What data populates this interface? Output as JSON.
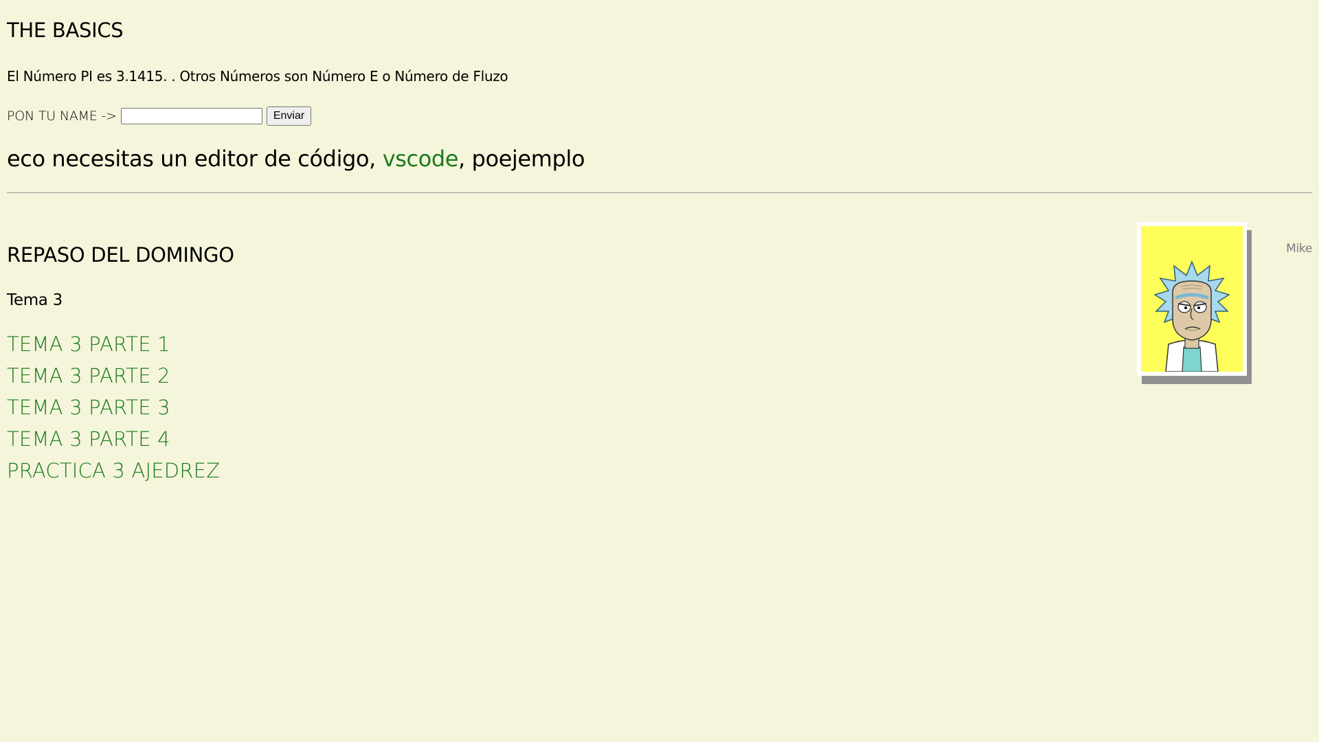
{
  "header": {
    "title": "THE BASICS"
  },
  "intro": {
    "text": "El Número PI es 3.1415. . Otros Números son Número E o Número de Fluzo"
  },
  "form": {
    "label": "PON TU NAME ->",
    "input_value": "",
    "input_placeholder": "",
    "submit_label": "Enviar"
  },
  "editor_line": {
    "before": "eco necesitas un editor de código, ",
    "link": "vscode",
    "after": ", poejemplo"
  },
  "section": {
    "title": "REPASO DEL DOMINGO",
    "subtitle": "Tema 3",
    "links": [
      "TEMA 3 PARTE 1",
      "TEMA 3 PARTE 2",
      "TEMA 3 PARTE 3",
      "TEMA 3 PARTE 4",
      "PRACTICA 3 AJEDREZ"
    ]
  },
  "aside": {
    "portrait": "rick-portrait-image",
    "author": "Mike"
  },
  "colors": {
    "background": "#f5f5dc",
    "link": "#1a7a1a",
    "portrait_bg": "#fefe5a"
  }
}
